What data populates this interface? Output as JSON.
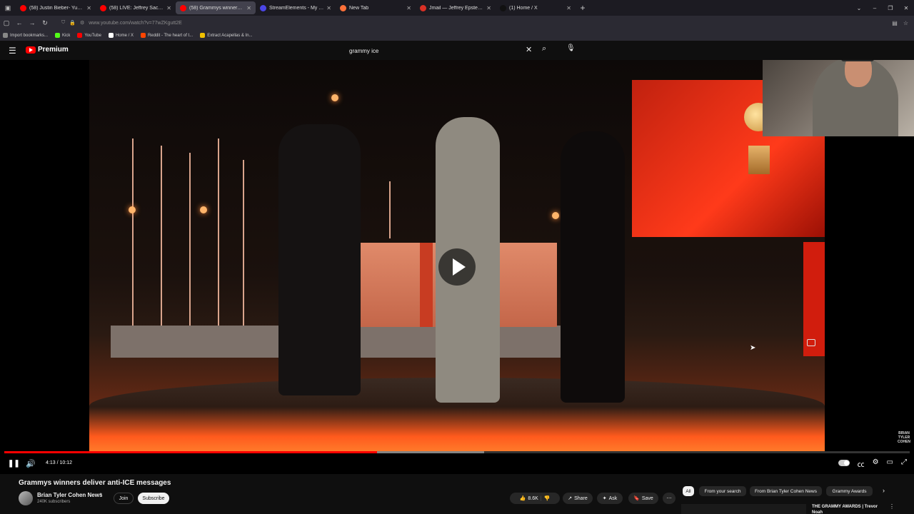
{
  "browser": {
    "tabs": [
      {
        "title": "(58) Justin Bieber- Yukon (Live a",
        "color": "#ff0000",
        "active": false
      },
      {
        "title": "(58) LIVE: Jeffrey Sachs With Ar",
        "color": "#ff0000",
        "active": false
      },
      {
        "title": "(58) Grammys winners deli",
        "color": "#ff0000",
        "active": true
      },
      {
        "title": "StreamElements - My dashboa",
        "color": "#4b46e6",
        "active": false
      },
      {
        "title": "New Tab",
        "color": "#ff7139",
        "active": false
      },
      {
        "title": "Jmail — Jeffrey Epstein's Emails",
        "color": "#d93025",
        "active": false
      },
      {
        "title": "(1) Home / X",
        "color": "#111111",
        "active": false
      }
    ],
    "url": "www.youtube.com/watch?v=77wZKgutt2E",
    "bookmarks": [
      "Import bookmarks...",
      "Kick",
      "YouTube",
      "Home / X",
      "Reddit - The heart of t...",
      "Extract Acapellas & In..."
    ],
    "bookmark_colors": [
      "#888888",
      "#53fc18",
      "#ff0000",
      "#ffffff",
      "#ff4500",
      "#f0c000"
    ]
  },
  "yt": {
    "logo_text": "Premium",
    "search_value": "grammy ice",
    "player": {
      "time_current": "4:13",
      "time_total": "10:12",
      "timecode": "4:13 / 10:12",
      "progress_fraction": 0.412,
      "buffer_fraction": 0.53,
      "watermark": "BRIAN TYLER COHEN"
    },
    "video": {
      "title": "Grammys winners deliver anti-ICE messages",
      "channel": "Brian Tyler Cohen News",
      "subscribers": "240K subscribers",
      "join_label": "Join",
      "subscribe_label": "Subscribe",
      "likes": "8.6K",
      "share_label": "Share",
      "ask_label": "Ask",
      "save_label": "Save"
    },
    "chips": [
      "All",
      "From your search",
      "From Brian Tyler Cohen News",
      "Grammy Awards"
    ],
    "recommendation": {
      "title": "THE GRAMMY AWARDS | Trevor Noah"
    }
  }
}
